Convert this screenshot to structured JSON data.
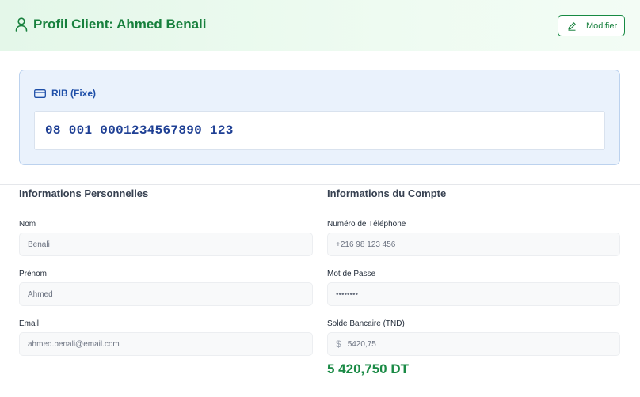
{
  "header": {
    "title": "Profil Client: Ahmed Benali",
    "edit_label": "Modifier"
  },
  "rib": {
    "title": "RIB (Fixe)",
    "value": "08 001 0001234567890 123"
  },
  "personal": {
    "heading": "Informations Personnelles",
    "fields": [
      {
        "label": "Nom",
        "value": "Benali"
      },
      {
        "label": "Prénom",
        "value": "Ahmed"
      },
      {
        "label": "Email",
        "value": "ahmed.benali@email.com"
      }
    ]
  },
  "account": {
    "heading": "Informations du Compte",
    "fields": [
      {
        "label": "Numéro de Téléphone",
        "value": "+216 98 123 456"
      },
      {
        "label": "Mot de Passe",
        "value": "••••••••"
      },
      {
        "label": "Solde Bancaire (TND)",
        "value": "5420,75",
        "prefix": "$"
      }
    ],
    "balance_display": "5 420,750 DT"
  },
  "icons": {
    "title": "user-icon",
    "edit": "pencil-icon",
    "rib": "credit-card-icon",
    "currency": "dollar-icon"
  },
  "colors": {
    "brand_green": "#17803d",
    "rib_blue": "#1e4fa8",
    "header_bg": "#e4f7e9",
    "rib_bg": "#eaf2fc"
  }
}
